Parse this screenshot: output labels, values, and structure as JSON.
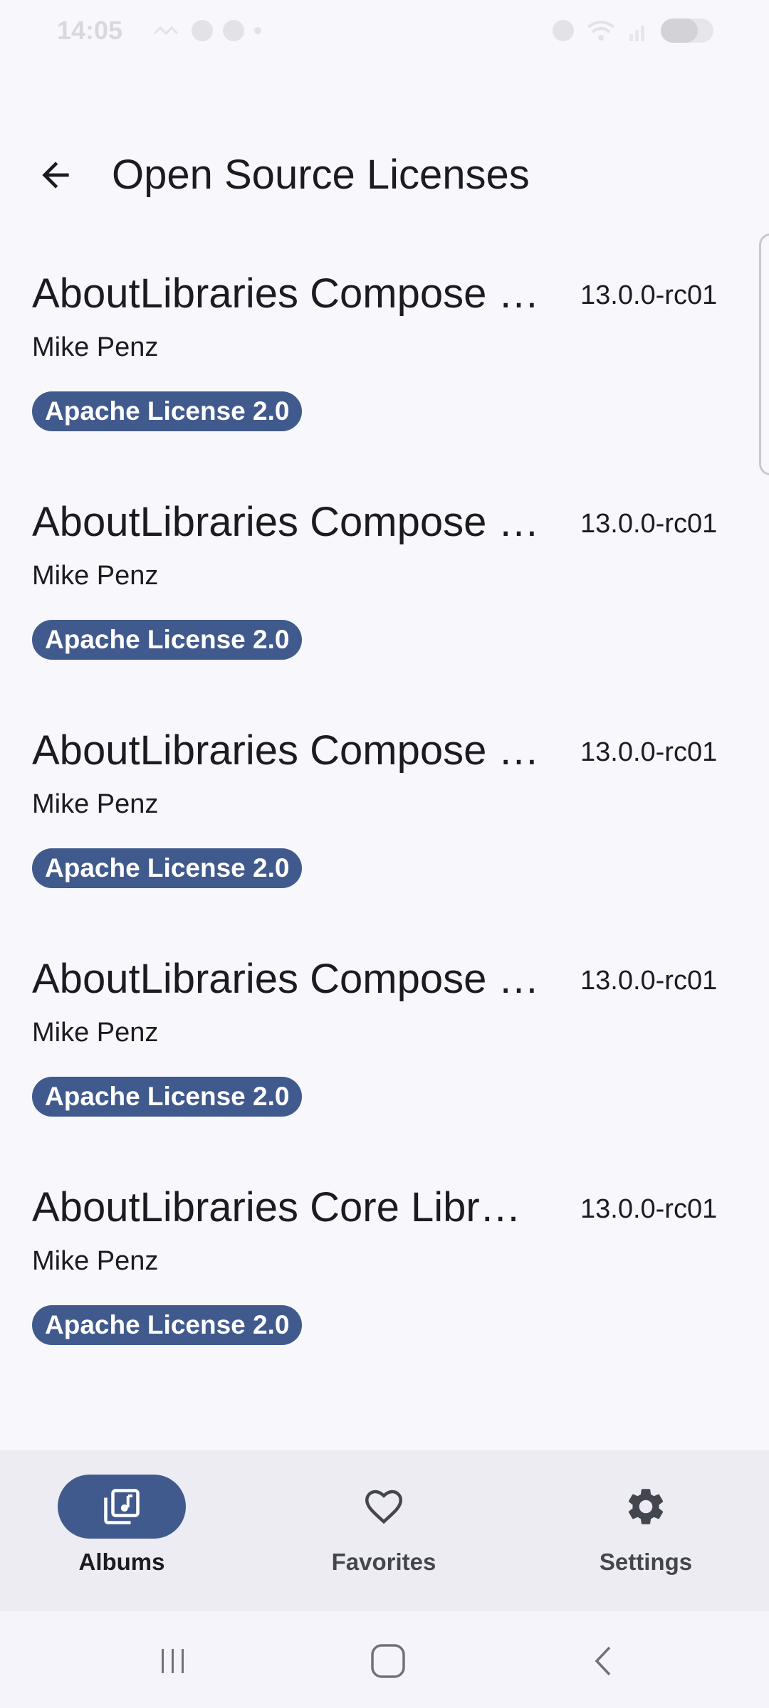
{
  "status_bar": {
    "time": "14:05",
    "battery_level": 0.7
  },
  "header": {
    "title": "Open Source Licenses"
  },
  "libraries": [
    {
      "name": "AboutLibraries Compose …",
      "version": "13.0.0-rc01",
      "author": "Mike Penz",
      "license": "Apache License 2.0"
    },
    {
      "name": "AboutLibraries Compose …",
      "version": "13.0.0-rc01",
      "author": "Mike Penz",
      "license": "Apache License 2.0"
    },
    {
      "name": "AboutLibraries Compose …",
      "version": "13.0.0-rc01",
      "author": "Mike Penz",
      "license": "Apache License 2.0"
    },
    {
      "name": "AboutLibraries Compose …",
      "version": "13.0.0-rc01",
      "author": "Mike Penz",
      "license": "Apache License 2.0"
    },
    {
      "name": "AboutLibraries Core Libr…",
      "version": "13.0.0-rc01",
      "author": "Mike Penz",
      "license": "Apache License 2.0"
    }
  ],
  "bottom_nav": {
    "items": [
      {
        "label": "Albums",
        "icon": "photo-album-icon",
        "active": true
      },
      {
        "label": "Favorites",
        "icon": "heart-icon",
        "active": false
      },
      {
        "label": "Settings",
        "icon": "gear-icon",
        "active": false
      }
    ]
  },
  "system_nav": {
    "buttons": [
      "recents-icon",
      "home-icon",
      "back-icon"
    ]
  },
  "colors": {
    "background": "#F8F8FC",
    "accent": "#415A8E",
    "nav_background": "#ECECF2",
    "text": "#1B1B20"
  }
}
